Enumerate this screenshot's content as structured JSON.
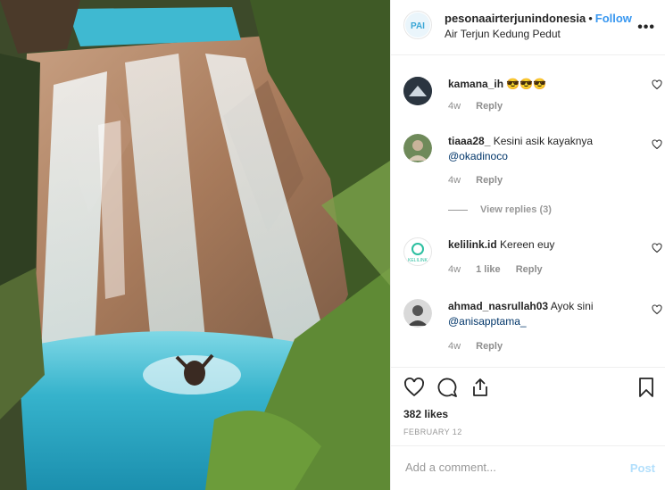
{
  "header": {
    "username": "pesonaairterjunindonesia",
    "separator": "•",
    "follow_label": "Follow",
    "location": "Air Terjun Kedung Pedut",
    "more_icon": "more-horizontal-icon"
  },
  "comments": [
    {
      "username": "kamana_ih",
      "text": "",
      "emoji": "😎😎😎",
      "age": "4w",
      "likes": "",
      "reply_label": "Reply"
    },
    {
      "username": "tiaaa28_",
      "text": "Kesini asik kayaknya",
      "mention": "@okadinoco",
      "age": "4w",
      "likes": "",
      "reply_label": "Reply"
    },
    {
      "username": "kelilink.id",
      "text": "Kereen euy",
      "age": "4w",
      "likes": "1 like",
      "reply_label": "Reply"
    },
    {
      "username": "ahmad_nasrullah03",
      "text": "Ayok sini",
      "mention": "@anisapptama_",
      "age": "4w",
      "likes": "",
      "reply_label": "Reply"
    }
  ],
  "view_replies": "View replies (3)",
  "kelilink_logo_text": "KELILINK",
  "actions": {
    "likes": "382 likes",
    "date": "FEBRUARY 12",
    "icons": [
      "heart-icon",
      "comment-icon",
      "share-icon",
      "bookmark-icon"
    ]
  },
  "add_comment": {
    "placeholder": "Add a comment...",
    "post_label": "Post"
  },
  "colors": {
    "link": "#3897f0",
    "mention": "#003569",
    "muted": "#8e8e8e",
    "water": "#3cb6cf"
  }
}
